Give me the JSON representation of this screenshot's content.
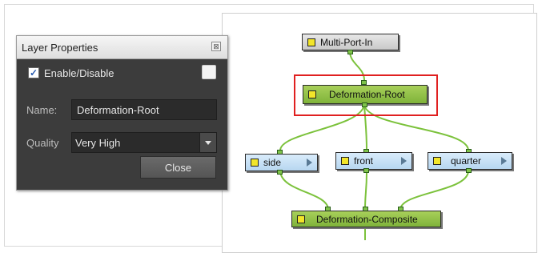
{
  "layer_properties": {
    "title": "Layer Properties",
    "close_icon": "⊠",
    "enable_label": "Enable/Disable",
    "enable_checked": true,
    "check_mark": "✓",
    "name_label": "Name:",
    "name_value": "Deformation-Root",
    "quality_label": "Quality",
    "quality_value": "Very High",
    "close_button": "Close"
  },
  "nodes": {
    "multi_port_in": "Multi-Port-In",
    "deformation_root": "Deformation-Root",
    "side": "side",
    "front": "front",
    "quarter": "quarter",
    "deformation_composite": "Deformation-Composite"
  },
  "colors": {
    "wire": "#7cc23c",
    "selection": "#e02020",
    "panel_bg": "#3c3c3c"
  }
}
